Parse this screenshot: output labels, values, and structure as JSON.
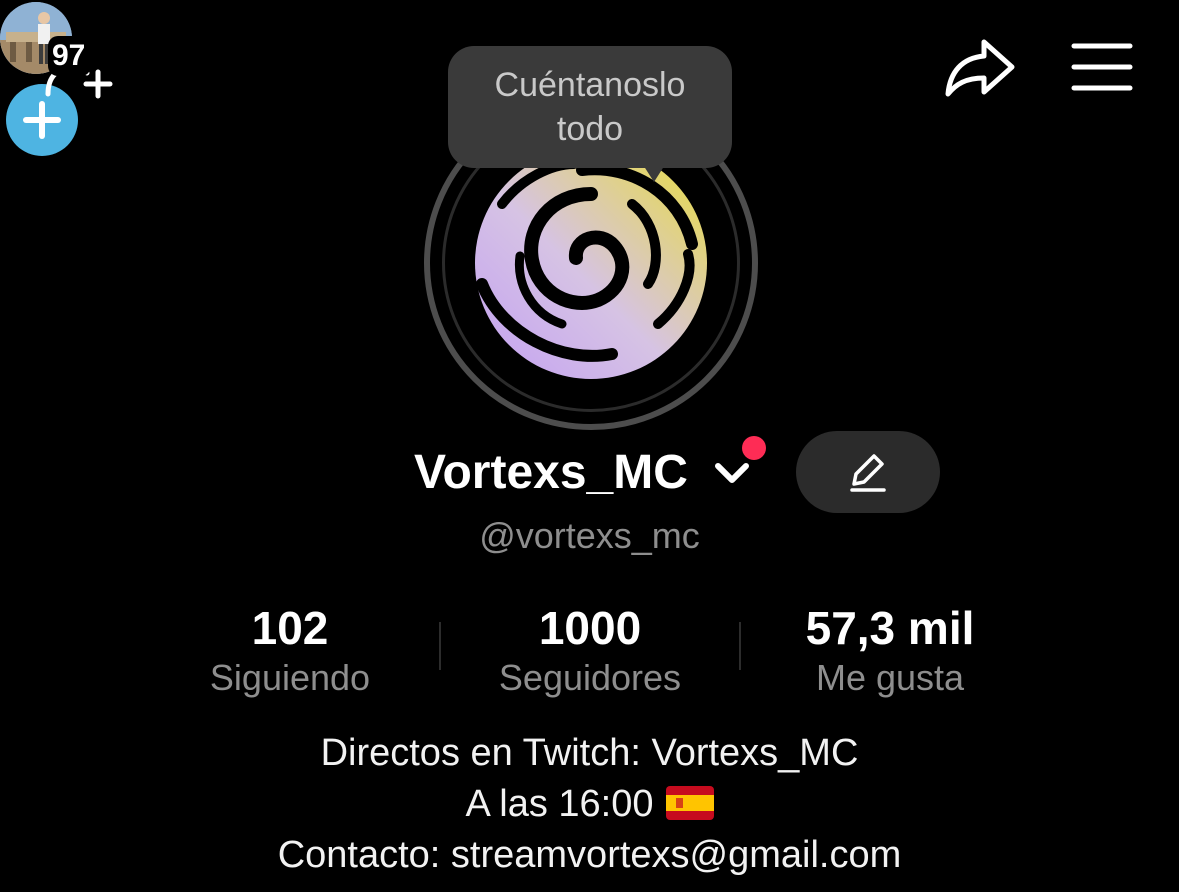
{
  "header": {
    "visitor_count": "97"
  },
  "tooltip": {
    "line1": "Cuéntanoslo",
    "line2": "todo"
  },
  "profile": {
    "display_name": "Vortexs_MC",
    "username": "@vortexs_mc"
  },
  "stats": [
    {
      "value": "102",
      "label": "Siguiendo"
    },
    {
      "value": "1000",
      "label": "Seguidores"
    },
    {
      "value": "57,3 mil",
      "label": "Me gusta"
    }
  ],
  "bio": {
    "line1": "Directos en Twitch: Vortexs_MC",
    "line2": "A las 16:00",
    "line3": "Contacto: streamvortexs@gmail.com"
  },
  "colors": {
    "background": "#000000",
    "add_story_blue": "#4eb4e2",
    "notification_red": "#fe2c55",
    "tooltip_bg": "#3a3a3a",
    "secondary_text": "#8e8e8e"
  },
  "icons": {
    "top_left": "add-friend-icon",
    "top_right": [
      "share-icon",
      "menu-icon"
    ],
    "avatar_badge": "plus-icon",
    "edit": "pencil-icon",
    "bio_flag": "spain-flag-icon"
  }
}
